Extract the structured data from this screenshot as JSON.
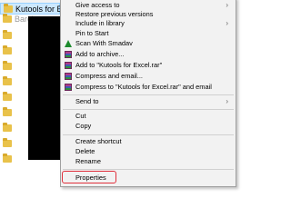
{
  "explorer": {
    "selected_folder": "Kutools for Excel",
    "second_folder_partial": "Barch"
  },
  "menu": {
    "give_access": "Give access to",
    "restore": "Restore previous versions",
    "include_library": "Include in library",
    "pin_start": "Pin to Start",
    "scan_smadav": "Scan With Smadav",
    "add_archive": "Add to archive...",
    "add_rar": "Add to \"Kutools for Excel.rar\"",
    "compress_email": "Compress and email...",
    "compress_rar_email": "Compress to \"Kutools for Excel.rar\" and email",
    "send_to": "Send to",
    "cut": "Cut",
    "copy": "Copy",
    "create_shortcut": "Create shortcut",
    "delete": "Delete",
    "rename": "Rename",
    "properties": "Properties"
  },
  "colors": {
    "highlight_border": "#e0303c",
    "selection": "#cce8ff",
    "menu_bg": "#f2f2f2"
  },
  "icons": {
    "submenu_arrow": "chevron-right-icon",
    "archive": "winrar-icon",
    "antivirus": "smadav-icon",
    "folder": "folder-icon"
  }
}
